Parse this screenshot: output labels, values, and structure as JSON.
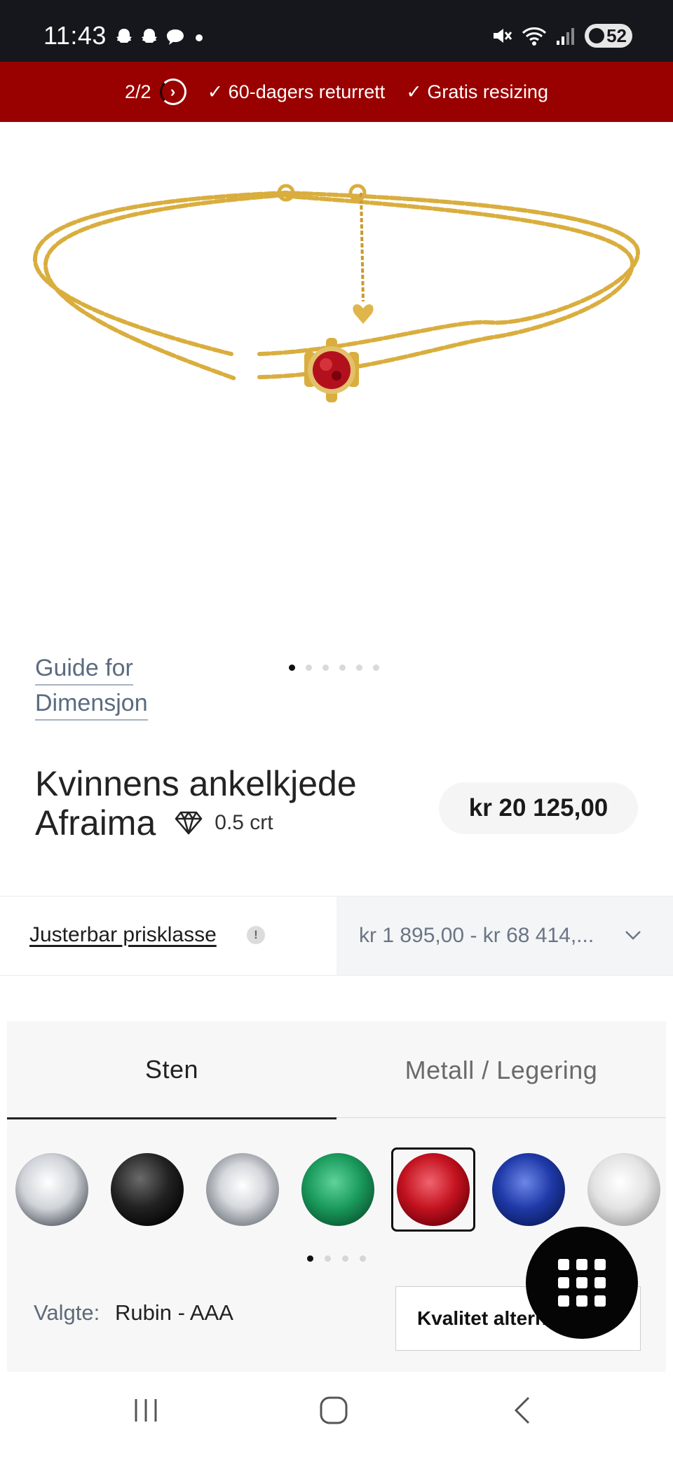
{
  "status_bar": {
    "time": "11:43",
    "battery": "52",
    "network": "5"
  },
  "promo": {
    "counter": "2/2",
    "items": [
      "✓ 60-dagers returrett",
      "✓ Gratis resizing"
    ]
  },
  "gallery": {
    "size_guide_line1": "Guide for",
    "size_guide_line2": "Dimensjon",
    "dots_total": 6,
    "dots_active": 0
  },
  "product": {
    "title_line1": "Kvinnens ankelkjede",
    "title_line2": "Afraima",
    "carat": "0.5 crt",
    "price": "kr 20 125,00"
  },
  "price_range": {
    "label": "Justerbar prisklasse",
    "info": "!",
    "value": "kr 1 895,00 - kr 68 414,..."
  },
  "options": {
    "tabs": [
      "Sten",
      "Metall / Legering"
    ],
    "active_tab": 0,
    "stones": [
      "diamond",
      "black-diamond",
      "lab-diamond",
      "emerald",
      "ruby",
      "sapphire",
      "moissanite"
    ],
    "selected_stone": 4,
    "dots_total": 4,
    "dots_active": 0,
    "selected_label": "Valgte:",
    "selected_value": "Rubin - AAA",
    "quality_button": "Kvalitet alternativ"
  },
  "colors": {
    "promo_bg": "#990000",
    "status_bg": "#15171c",
    "gold": "#d9ae3e",
    "ruby": "#b3101d"
  }
}
